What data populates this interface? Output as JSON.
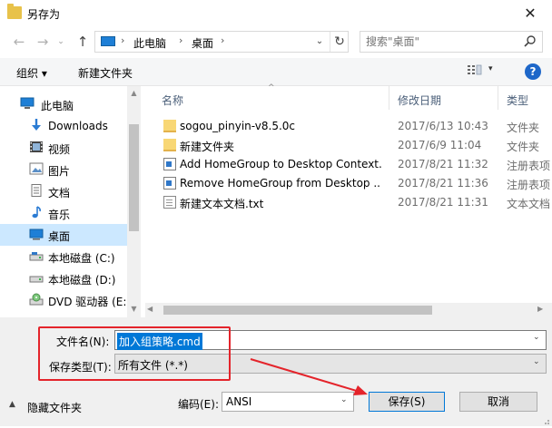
{
  "window": {
    "title": "另存为",
    "close_glyph": "✕"
  },
  "address": {
    "crumbs": [
      "此电脑",
      "桌面"
    ],
    "separator": "›",
    "dropdown_glyph": "⌄",
    "refresh_glyph": "↻"
  },
  "nav_buttons": {
    "back": "←",
    "forward": "→",
    "recent": "⌄",
    "up": "↑"
  },
  "search": {
    "placeholder": "搜索\"桌面\""
  },
  "toolbar": {
    "organize_label": "组织 ▾",
    "new_folder_label": "新建文件夹",
    "view_drop": "▾",
    "help_label": "?"
  },
  "sidebar": {
    "items": [
      {
        "label": "此电脑",
        "icon": "pc-icon"
      },
      {
        "label": "Downloads",
        "icon": "download-icon"
      },
      {
        "label": "视频",
        "icon": "video-icon"
      },
      {
        "label": "图片",
        "icon": "pictures-icon"
      },
      {
        "label": "文档",
        "icon": "documents-icon"
      },
      {
        "label": "音乐",
        "icon": "music-icon"
      },
      {
        "label": "桌面",
        "icon": "desktop-icon",
        "selected": true
      },
      {
        "label": "本地磁盘 (C:)",
        "icon": "drive-icon"
      },
      {
        "label": "本地磁盘 (D:)",
        "icon": "drive-icon"
      },
      {
        "label": "DVD 驱动器 (E:)",
        "icon": "dvd-icon"
      }
    ],
    "scroll_up": "▲",
    "scroll_down": "▼"
  },
  "files": {
    "columns": {
      "name": "名称",
      "date": "修改日期",
      "type": "类型",
      "sort_glyph": "^"
    },
    "rows": [
      {
        "name": "sogou_pinyin-v8.5.0c",
        "date": "2017/6/13 10:43",
        "type": "文件夹",
        "icon": "folder-icon"
      },
      {
        "name": "新建文件夹",
        "date": "2017/6/9 11:04",
        "type": "文件夹",
        "icon": "folder-icon"
      },
      {
        "name": "Add HomeGroup to Desktop Context...",
        "date": "2017/8/21 11:32",
        "type": "注册表项",
        "icon": "registry-file-icon"
      },
      {
        "name": "Remove HomeGroup from Desktop ...",
        "date": "2017/8/21 11:36",
        "type": "注册表项",
        "icon": "registry-file-icon"
      },
      {
        "name": "新建文本文档.txt",
        "date": "2017/8/21 11:31",
        "type": "文本文档",
        "icon": "text-file-icon"
      }
    ],
    "h_scroll_left": "◀",
    "h_scroll_right": "▶"
  },
  "form": {
    "filename_label": "文件名(N):",
    "filename_value": "加入组策略.cmd",
    "filetype_label": "保存类型(T):",
    "filetype_value": "所有文件  (*.*)",
    "drop_glyph": "⌄",
    "hide_folders_glyph": "▲",
    "hide_folders_label": "隐藏文件夹",
    "encoding_label": "编码(E):",
    "encoding_value": "ANSI",
    "save_label": "保存(S)",
    "cancel_label": "取消"
  },
  "colors": {
    "accent": "#0078d7",
    "annotation_red": "#e4242b",
    "selected_bg": "#cce8ff"
  }
}
